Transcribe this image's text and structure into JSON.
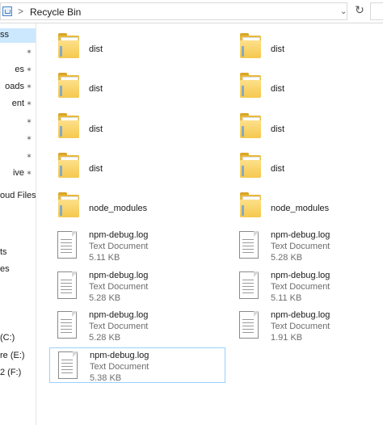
{
  "address": {
    "separator": ">",
    "path": "Recycle Bin",
    "dropdown_glyph": "⌄",
    "refresh_glyph": "↻"
  },
  "nav": {
    "items": [
      {
        "label": "ss",
        "pinned": false,
        "selected": true
      },
      {
        "label": "",
        "pinned": true
      },
      {
        "label": "es",
        "pinned": true
      },
      {
        "label": "oads",
        "pinned": true
      },
      {
        "label": "ent",
        "pinned": true
      },
      {
        "label": "",
        "pinned": true
      },
      {
        "label": "",
        "pinned": true
      },
      {
        "label": "",
        "pinned": true
      },
      {
        "label": "ive",
        "pinned": true
      },
      {
        "label": "oud Files",
        "pinned": false
      },
      {
        "label": "ts",
        "pinned": false
      },
      {
        "label": "es",
        "pinned": false
      },
      {
        "label": "(C:)",
        "pinned": false
      },
      {
        "label": "re (E:)",
        "pinned": false
      },
      {
        "label": "2 (F:)",
        "pinned": false
      }
    ],
    "pin_glyph": "📌"
  },
  "content": {
    "items": [
      {
        "kind": "folder",
        "name": "dist"
      },
      {
        "kind": "folder",
        "name": "dist"
      },
      {
        "kind": "folder",
        "name": "dist"
      },
      {
        "kind": "folder",
        "name": "dist"
      },
      {
        "kind": "folder",
        "name": "dist"
      },
      {
        "kind": "folder",
        "name": "dist"
      },
      {
        "kind": "folder",
        "name": "dist"
      },
      {
        "kind": "folder",
        "name": "dist"
      },
      {
        "kind": "folder",
        "name": "node_modules"
      },
      {
        "kind": "folder",
        "name": "node_modules"
      },
      {
        "kind": "file",
        "name": "npm-debug.log",
        "type": "Text Document",
        "size": "5.11 KB"
      },
      {
        "kind": "file",
        "name": "npm-debug.log",
        "type": "Text Document",
        "size": "5.28 KB"
      },
      {
        "kind": "file",
        "name": "npm-debug.log",
        "type": "Text Document",
        "size": "5.28 KB"
      },
      {
        "kind": "file",
        "name": "npm-debug.log",
        "type": "Text Document",
        "size": "5.11 KB"
      },
      {
        "kind": "file",
        "name": "npm-debug.log",
        "type": "Text Document",
        "size": "5.28 KB"
      },
      {
        "kind": "file",
        "name": "npm-debug.log",
        "type": "Text Document",
        "size": "1.91 KB"
      },
      {
        "kind": "file",
        "name": "npm-debug.log",
        "type": "Text Document",
        "size": "5.38 KB",
        "outlined": true
      }
    ]
  }
}
